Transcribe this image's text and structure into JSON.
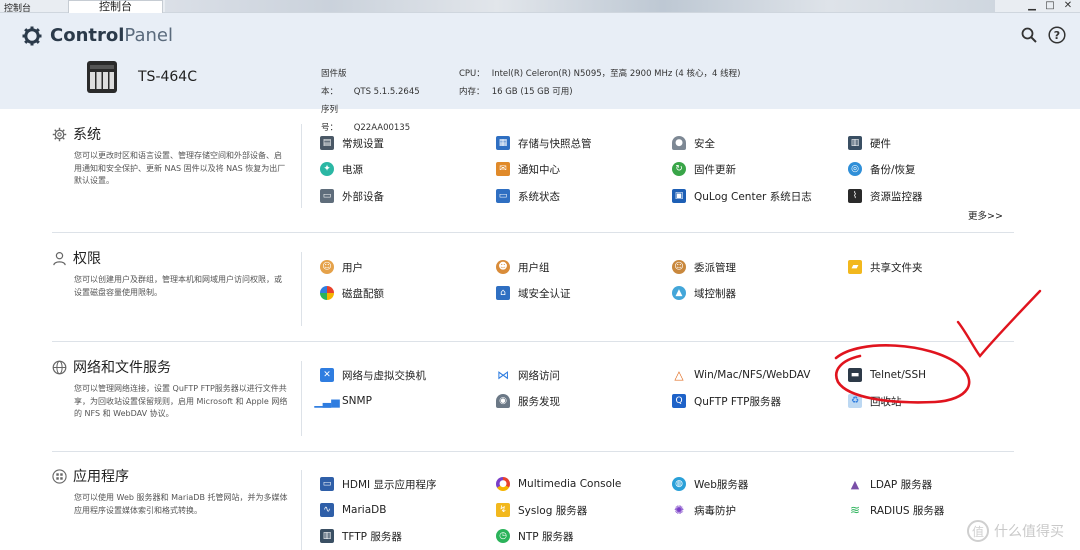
{
  "window": {
    "title": "控制台",
    "tab_label": "控制台",
    "controls": [
      "▁",
      "□",
      "✕"
    ]
  },
  "header": {
    "brand_bold": "Control",
    "brand_light": "Panel",
    "device_model": "TS-464C",
    "firmware_label": "固件版本：",
    "firmware_value": "QTS 5.1.5.2645",
    "serial_label": "序列号：",
    "serial_value": "Q22AA00135",
    "cpu_label": "CPU：",
    "cpu_value": "Intel(R) Celeron(R) N5095，至高 2900 MHz (4 核心，4 线程)",
    "memory_label": "内存：",
    "memory_value": "16 GB (15 GB 可用)"
  },
  "sections": [
    {
      "title": "系统",
      "desc": "您可以更改时区和语言设置、管理存储空间和外部设备、启用通知和安全保护、更新 NAS 固件以及将 NAS 恢复为出厂默认设置。",
      "items": [
        "常规设置",
        "存储与快照总管",
        "安全",
        "硬件",
        "电源",
        "通知中心",
        "固件更新",
        "备份/恢复",
        "外部设备",
        "系统状态",
        "QuLog Center 系统日志",
        "资源监控器"
      ],
      "more": "更多>>"
    },
    {
      "title": "权限",
      "desc": "您可以创建用户及群组，管理本机和网域用户访问权限，或设置磁盘容量使用限制。",
      "items": [
        "用户",
        "用户组",
        "委派管理",
        "共享文件夹",
        "磁盘配额",
        "域安全认证",
        "域控制器"
      ]
    },
    {
      "title": "网络和文件服务",
      "desc": "您可以管理网络连接，设置 QuFTP FTP服务器以进行文件共享，为回收站设置保留规则，启用 Microsoft 和 Apple 网络的 NFS 和 WebDAV 协议。",
      "items": [
        "网络与虚拟交换机",
        "网络访问",
        "Win/Mac/NFS/WebDAV",
        "Telnet/SSH",
        "SNMP",
        "服务发现",
        "QuFTP FTP服务器",
        "回收站"
      ]
    },
    {
      "title": "应用程序",
      "desc": "您可以使用 Web 服务器和 MariaDB 托管网站，并为多媒体应用程序设置媒体索引和格式转换。",
      "items": [
        "HDMI 显示应用程序",
        "Multimedia Console",
        "Web服务器",
        "LDAP 服务器",
        "MariaDB",
        "Syslog 服务器",
        "病毒防护",
        "RADIUS 服务器",
        "TFTP 服务器",
        "NTP 服务器"
      ]
    }
  ],
  "watermark": "什么值得买",
  "colors": {
    "header_bg": "#e8eef6",
    "annotation": "#e0141e"
  }
}
